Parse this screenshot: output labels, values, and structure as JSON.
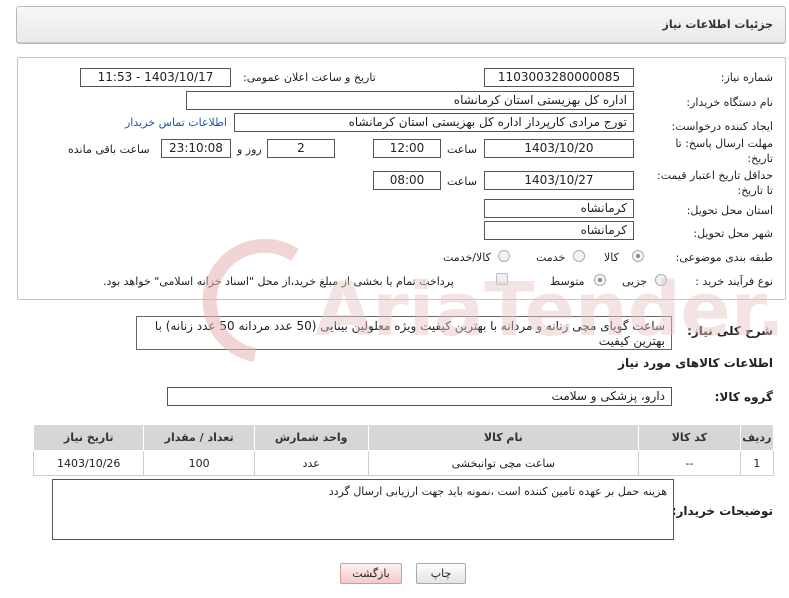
{
  "header": {
    "title": "جزئیات اطلاعات نیاز"
  },
  "form": {
    "need_number_label": "شماره نیاز:",
    "need_number": "1103003280000085",
    "announce_label": "تاریخ و ساعت اعلان عمومی:",
    "announce_value": "1403/10/17 - 11:53",
    "buyer_org_label": "نام دستگاه خریدار:",
    "buyer_org": "اداره کل بهزیستی استان کرمانشاه",
    "creator_label": "ایجاد کننده درخواست:",
    "creator": "تورج مرادی کارپرداز  اداره کل بهزیستی استان کرمانشاه",
    "contact_link": "اطلاعات تماس خریدار",
    "deadline_label": "مهلت ارسال پاسخ: تا تاریخ:",
    "deadline_date": "1403/10/20",
    "time_label": "ساعت",
    "deadline_time": "12:00",
    "days_value": "2",
    "days_label": "روز و",
    "remaining_time": "23:10:08",
    "remaining_label": "ساعت باقی مانده",
    "validity_label": "حداقل تاریخ اعتبار قیمت: تا تاریخ:",
    "validity_date": "1403/10/27",
    "validity_time": "08:00",
    "province_label": "استان محل تحویل:",
    "province": "کرمانشاه",
    "city_label": "شهر محل تحویل:",
    "city": "کرمانشاه",
    "category_label": "طبقه بندی موضوعی:",
    "category_options": [
      "کالا",
      "خدمت",
      "کالا/خدمت"
    ],
    "purchase_type_label": "نوع فرآیند خرید :",
    "purchase_options": [
      "جزیی",
      "متوسط"
    ],
    "payment_note": "پرداخت تمام یا بخشی از مبلغ خرید،از محل \"اسناد خزانه اسلامی\" خواهد بود."
  },
  "description": {
    "label": "شرح کلی نیاز:",
    "text": "ساعت گویای مچی زنانه و مردانه با بهترین کیفیت ویژه معلولین بینایی (50 عدد مردانه 50 عدد زنانه) با بهترین کیفیت"
  },
  "goods": {
    "section_title": "اطلاعات کالاهای مورد نیاز",
    "group_label": "گروه کالا:",
    "group_value": "دارو، پزشکی و سلامت",
    "columns": [
      "ردیف",
      "کد کالا",
      "نام کالا",
      "واحد شمارش",
      "تعداد / مقدار",
      "تاریخ نیاز"
    ],
    "rows": [
      [
        "1",
        "--",
        "ساعت مچی توانبخشی",
        "عدد",
        "100",
        "1403/10/26"
      ]
    ]
  },
  "notes": {
    "label": "توضیحات خریدار:",
    "text": "هزینه حمل بر عهده تامین کننده است ،نمونه باید جهت ارزیابی ارسال گردد"
  },
  "buttons": {
    "print": "چاپ",
    "back": "بازگشت"
  },
  "colors": {
    "link": "#1a57b8",
    "table_header": "#d6d6d6",
    "back_button": "#f4c9c9"
  }
}
